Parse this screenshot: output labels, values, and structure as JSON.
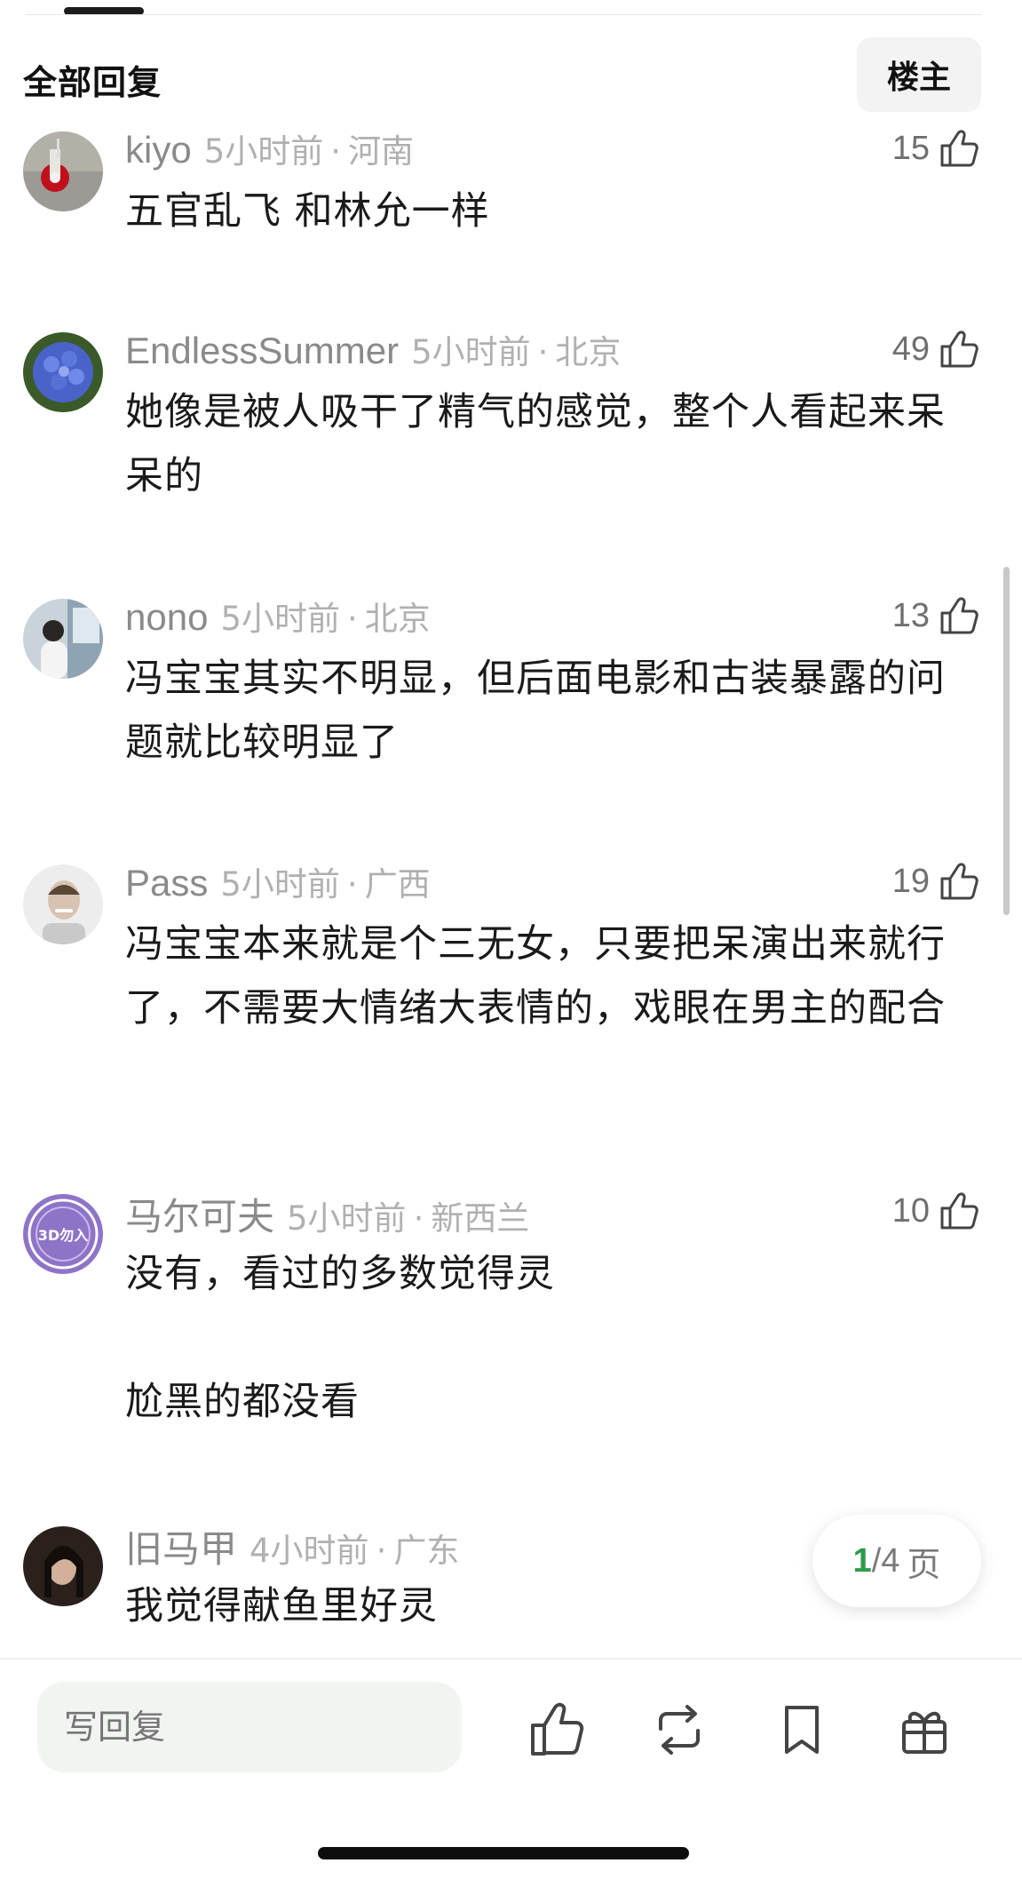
{
  "header": {
    "title": "全部回复",
    "op_filter_label": "楼主"
  },
  "comments": [
    {
      "username": "kiyo",
      "time": "5小时前",
      "location": "河南",
      "likes": "15",
      "text": "五官乱飞 和林允一样",
      "avatar_icon": "drink-cup-photo"
    },
    {
      "username": "EndlessSummer",
      "time": "5小时前",
      "location": "北京",
      "likes": "49",
      "text": "她像是被人吸干了精气的感觉，整个人看起来呆呆的",
      "avatar_icon": "hydrangea-flower-photo"
    },
    {
      "username": "nono",
      "time": "5小时前",
      "location": "北京",
      "likes": "13",
      "text": "冯宝宝其实不明显，但后面电影和古装暴露的问题就比较明显了",
      "avatar_icon": "woman-at-window-photo"
    },
    {
      "username": "Pass",
      "time": "5小时前",
      "location": "广西",
      "likes": "19",
      "text": "冯宝宝本来就是个三无女，只要把呆演出来就行了，不需要大情绪大表情的，戏眼在男主的配合",
      "avatar_icon": "smiling-man-photo"
    },
    {
      "username": "马尔可夫",
      "time": "5小时前",
      "location": "新西兰",
      "likes": "10",
      "text_line1": "没有，看过的多数觉得灵",
      "text_line2": "尬黑的都没看",
      "avatar_icon": "3d-badge-avatar",
      "avatar_text": "3D勿入"
    },
    {
      "username": "旧马甲",
      "time": "4小时前",
      "location": "广东",
      "likes": "",
      "text": "我觉得献鱼里好灵",
      "avatar_icon": "dark-portrait-photo"
    }
  ],
  "pager": {
    "current": "1",
    "total": "/4",
    "unit": "页"
  },
  "bottom_bar": {
    "reply_placeholder": "写回复",
    "actions": [
      "thumbs-up-icon",
      "repost-icon",
      "bookmark-icon",
      "gift-icon"
    ]
  },
  "colors": {
    "username": "#8a8a8a",
    "meta": "#b0b0b0",
    "pager_current": "#2e9a4c",
    "input_bg": "#f1f4f1"
  }
}
